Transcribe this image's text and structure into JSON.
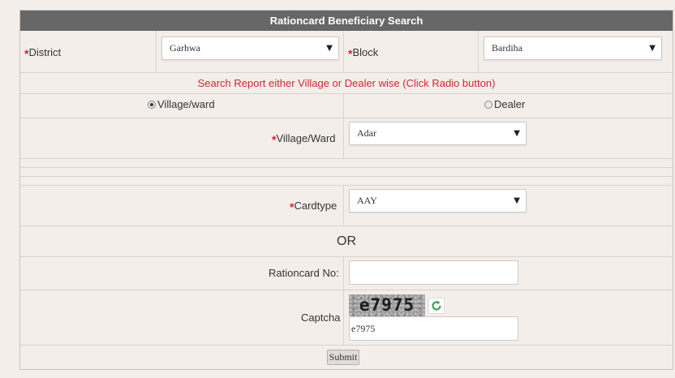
{
  "header": {
    "title": "Rationcard Beneficiary Search"
  },
  "district": {
    "required": "*",
    "label": "District",
    "value": "Garhwa"
  },
  "block": {
    "required": "*",
    "label": "Block",
    "value": "Bardiha"
  },
  "notice": "Search Report either Village or Dealer wise (Click Radio button)",
  "search_mode": {
    "village_label": "Village/ward",
    "dealer_label": "Dealer",
    "selected": "Village/ward"
  },
  "village": {
    "required": "*",
    "label": "Village/Ward",
    "value": "Adar"
  },
  "cardtype": {
    "required": "*",
    "label": "Cardtype",
    "value": "AAY"
  },
  "or_text": "OR",
  "rationcard": {
    "label": "Rationcard No:",
    "value": ""
  },
  "captcha": {
    "label": "Captcha",
    "image_text": "e7975",
    "input_value": "e7975"
  },
  "submit_label": "Submit",
  "colors": {
    "header_bg": "#676767",
    "required": "#d9232d",
    "page_bg": "#f4eeeb"
  }
}
